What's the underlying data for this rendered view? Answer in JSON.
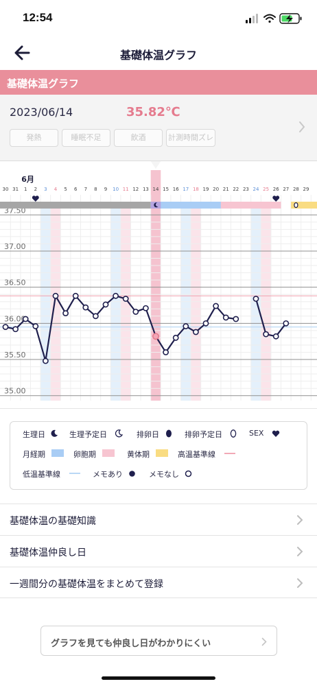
{
  "status_bar": {
    "time": "12:54"
  },
  "nav": {
    "title": "基礎体温グラフ"
  },
  "section_header": {
    "title": "基礎体温グラフ"
  },
  "info": {
    "date": "2023/06/14",
    "temperature": "35.82℃",
    "tags": [
      "発熱",
      "睡眠不足",
      "飲酒",
      "計測時間ズレ"
    ]
  },
  "chart_data": {
    "type": "line",
    "month_label": "6月",
    "days": [
      "30",
      "31",
      "1",
      "2",
      "3",
      "4",
      "5",
      "6",
      "7",
      "8",
      "9",
      "10",
      "11",
      "12",
      "13",
      "14",
      "15",
      "16",
      "17",
      "18",
      "19",
      "20",
      "21",
      "22",
      "23",
      "24",
      "25",
      "26",
      "27",
      "28",
      "29"
    ],
    "y_tick_labels": [
      "37.50",
      "37.00",
      "36.50",
      "36.00",
      "35.50",
      "35.00"
    ],
    "y_ticks": [
      37.5,
      37.0,
      36.5,
      36.0,
      35.5,
      35.0
    ],
    "ylim": [
      34.95,
      37.55
    ],
    "high_baseline": 36.38,
    "low_baseline": 35.95,
    "selected_day": "14",
    "series": [
      {
        "values": [
          35.95,
          35.92,
          36.06,
          35.96,
          35.48,
          36.38,
          36.14,
          36.38,
          36.22,
          36.1,
          36.26,
          36.38,
          36.34,
          36.16,
          36.21,
          35.82,
          35.6,
          35.8,
          35.96,
          35.88,
          36.0,
          36.24,
          36.08,
          36.06,
          null,
          36.34,
          35.85,
          35.82,
          36.0,
          null,
          null
        ]
      }
    ],
    "phases": [
      {
        "name": "月経期",
        "from": "30",
        "to": "14"
      },
      {
        "name": "月経期",
        "from": "14",
        "to": "20"
      },
      {
        "name": "卵胞期",
        "from": "21",
        "to": "26"
      },
      {
        "name": "黄体期",
        "from": "28",
        "to": "29"
      }
    ],
    "sex_days": [
      "2",
      "26"
    ],
    "period_day": "14",
    "ovulation_expected_day": "28",
    "grid": true
  },
  "legend": {
    "period": "生理日",
    "period_expected": "生理予定日",
    "ovulation": "排卵日",
    "ovulation_expected": "排卵予定日",
    "sex": "SEX",
    "menstrual_phase": "月経期",
    "follicular_phase": "卵胞期",
    "luteal_phase": "黄体期",
    "high_baseline": "高温基準線",
    "low_baseline": "低温基準線",
    "memo_yes": "メモあり",
    "memo_no": "メモなし"
  },
  "menu": [
    "基礎体温の基礎知識",
    "基礎体温仲良し日",
    "一週間分の基礎体温をまとめて登録"
  ],
  "help_button": {
    "label": "グラフを見ても仲良し日がわかりにくい"
  },
  "colors": {
    "accent_pink": "#e98f9b",
    "temp_pink": "#e57b8e",
    "line_navy": "#1f1f4d",
    "menstrual_gray": "#a6a6a6",
    "follicular_blue": "#a9cdf5",
    "luteal_pink": "#f7c5d1",
    "luteal_yellow": "#f9dc82"
  }
}
